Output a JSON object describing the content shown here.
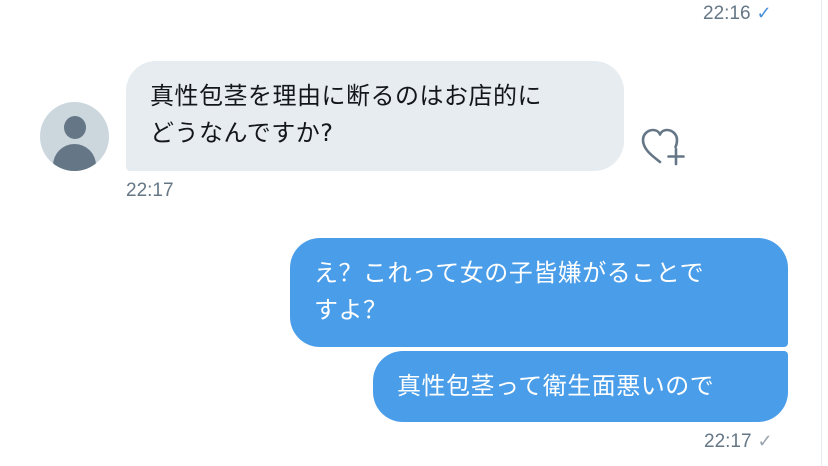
{
  "conversation": {
    "top_message": {
      "time": "22:16",
      "read_icon": "check-icon"
    },
    "incoming": {
      "avatar_icon": "default-user-avatar-icon",
      "lines": [
        "真性包茎を理由に断るのはお店的に",
        "どうなんですか?"
      ],
      "time": "22:17",
      "like_icon": "heart-plus-icon"
    },
    "outgoing": [
      {
        "lines": [
          "え？これって女の子皆嫌がることで",
          "すよ？"
        ]
      },
      {
        "lines": [
          "真性包茎って衛生面悪いので"
        ]
      }
    ],
    "outgoing_time": "22:17",
    "outgoing_read_icon": "check-icon"
  },
  "colors": {
    "incoming_bubble": "#e6ecf0",
    "outgoing_bubble": "#4a9de8",
    "timestamp": "#657786",
    "check_blue": "#4a90d9"
  }
}
